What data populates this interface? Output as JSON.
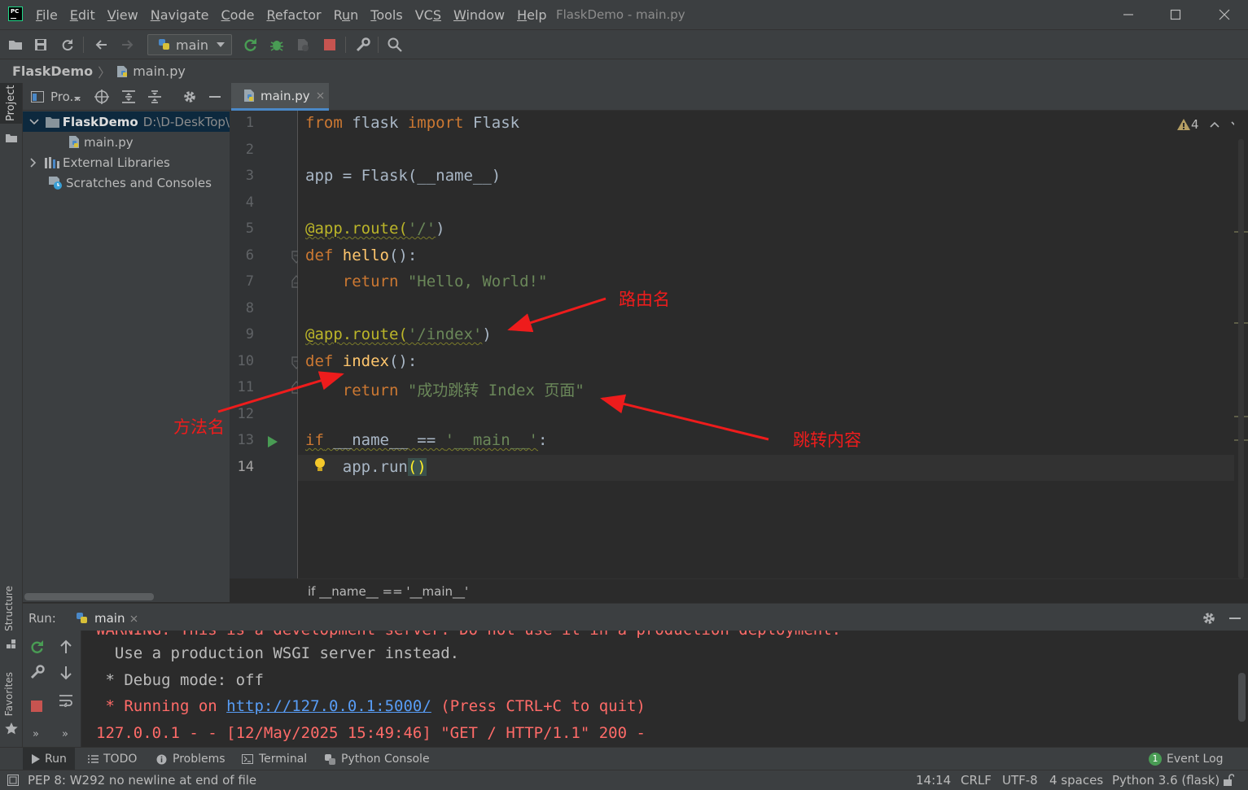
{
  "window": {
    "title": "FlaskDemo - main.py",
    "logo_text": "PC"
  },
  "menu": [
    {
      "pre": "",
      "u": "F",
      "post": "ile"
    },
    {
      "pre": "",
      "u": "E",
      "post": "dit"
    },
    {
      "pre": "",
      "u": "V",
      "post": "iew"
    },
    {
      "pre": "",
      "u": "N",
      "post": "avigate"
    },
    {
      "pre": "",
      "u": "C",
      "post": "ode"
    },
    {
      "pre": "",
      "u": "R",
      "post": "efactor"
    },
    {
      "pre": "R",
      "u": "u",
      "post": "n"
    },
    {
      "pre": "",
      "u": "T",
      "post": "ools"
    },
    {
      "pre": "VC",
      "u": "S",
      "post": ""
    },
    {
      "pre": "",
      "u": "W",
      "post": "indow"
    },
    {
      "pre": "",
      "u": "H",
      "post": "elp"
    }
  ],
  "toolbar": {
    "run_config": "main"
  },
  "breadcrumb": {
    "project": "FlaskDemo",
    "file": "main.py"
  },
  "left_strip": {
    "project": "Project",
    "structure": "Structure",
    "favorites": "Favorites"
  },
  "project_panel": {
    "header_label": "Pro...",
    "tree": {
      "root_name": "FlaskDemo",
      "root_path": "D:\\D-DeskTop\\",
      "file": "main.py",
      "external_libraries": "External Libraries",
      "scratches": "Scratches and Consoles"
    }
  },
  "editor": {
    "tab_label": "main.py",
    "warnings_count": "4",
    "line_numbers": [
      "1",
      "2",
      "3",
      "4",
      "5",
      "6",
      "7",
      "8",
      "9",
      "10",
      "11",
      "12",
      "13",
      "14"
    ],
    "code": {
      "l1_from": "from",
      "l1_mod": " flask ",
      "l1_import": "import",
      "l1_cls": " Flask",
      "l3": "app = Flask(__name__)",
      "l5_dec": "@app.route(",
      "l5_str": "'/'",
      "l5_end": ")",
      "l6_def": "def",
      "l6_name": "hello",
      "l6_end": "():",
      "l7_ret": "    return",
      "l7_str": " \"Hello, World!\"",
      "l9_dec": "@app.route(",
      "l9_str": "'/index'",
      "l9_end": ")",
      "l10_def": "def",
      "l10_name": "index",
      "l10_end": "():",
      "l11_ret": "    return",
      "l11_str": " \"成功跳转 Index 页面\"",
      "l13_if": "if",
      "l13_mid": " __name__ == ",
      "l13_str": "'__main__'",
      "l13_end": ":",
      "l14_pre": "    app.run",
      "l14_paren": "()"
    },
    "bottom_crumb": "if __name__ == '__main__'"
  },
  "annotations": {
    "route_name": "路由名",
    "method_name": "方法名",
    "redirect_content": "跳转内容"
  },
  "run_panel": {
    "label": "Run:",
    "tab": "main",
    "console": {
      "line0": "WARNING: This is a development server. Do not use it in a production deployment.",
      "line1": "  Use a production WSGI server instead.",
      "line2": " * Debug mode: off",
      "line3_prefix": " * Running on ",
      "line3_link": "http://127.0.0.1:5000/",
      "line3_suffix": " (Press CTRL+C to quit)",
      "line4": "127.0.0.1 - - [12/May/2025 15:49:46] \"GET / HTTP/1.1\" 200 -"
    }
  },
  "bottom_tabs": {
    "run": "Run",
    "todo": "TODO",
    "problems": "Problems",
    "terminal": "Terminal",
    "python_console": "Python Console",
    "event_log_count": "1",
    "event_log": "Event Log"
  },
  "status": {
    "message": "PEP 8: W292 no newline at end of file",
    "position": "14:14",
    "line_sep": "CRLF",
    "encoding": "UTF-8",
    "indent": "4 spaces",
    "interpreter": "Python 3.6 (flask)"
  },
  "colors": {
    "keyword": "#cc7832",
    "string": "#6a8759",
    "decorator": "#bbb529",
    "function": "#ffc66d",
    "annotation": "#ee1c1c",
    "console_red": "#ff6b68",
    "link": "#589df6"
  }
}
